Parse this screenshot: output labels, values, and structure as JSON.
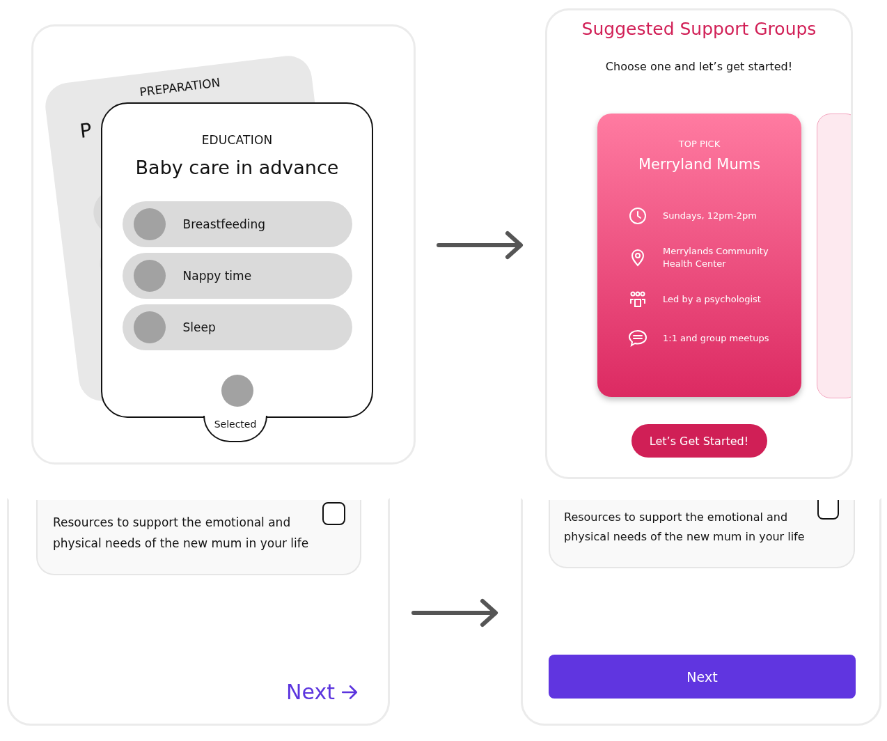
{
  "education_card": {
    "back_card": {
      "category": "PREPARATION",
      "title": "P"
    },
    "category": "EDUCATION",
    "title": "Baby care in advance",
    "options": [
      {
        "label": "Breastfeeding"
      },
      {
        "label": "Nappy time"
      },
      {
        "label": "Sleep"
      }
    ],
    "selector_label": "Selected"
  },
  "support_groups": {
    "title": "Suggested Support Groups",
    "subtitle": "Choose one and let’s get started!",
    "top_card": {
      "badge": "TOP PICK",
      "name": "Merryland Mums",
      "details": [
        {
          "kind": "clock",
          "text": "Sundays, 12pm-2pm"
        },
        {
          "kind": "pin",
          "text": "Merrylands Community Health Center"
        },
        {
          "kind": "people",
          "text": "Led by a psychologist"
        },
        {
          "kind": "chat",
          "text": "1:1 and group meetups"
        }
      ]
    },
    "button": "Let’s Get Started!"
  },
  "resource_before": {
    "text": "Resources to support the emotional and physical needs of the new mum in your life",
    "checked": false,
    "next_link": "Next"
  },
  "resource_after": {
    "text": "Resources to support the emotional and physical needs of the new mum in your life",
    "checked": false,
    "next_button": "Next"
  }
}
